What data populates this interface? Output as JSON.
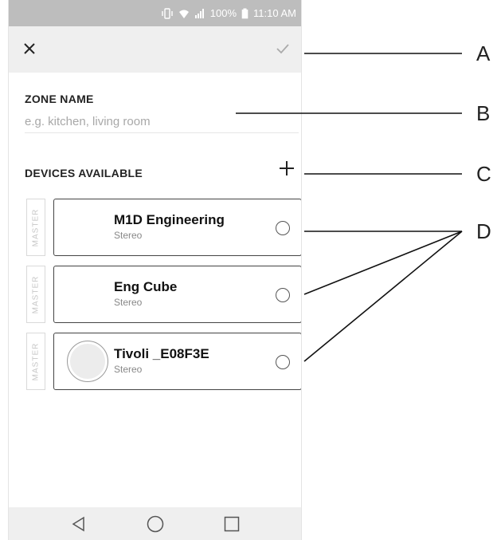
{
  "status_bar": {
    "battery": "100%",
    "time": "11:10 AM"
  },
  "toolbar": {
    "close_icon": "close-icon",
    "confirm_icon": "check-icon"
  },
  "zone": {
    "label": "ZONE NAME",
    "placeholder": "e.g. kitchen, living room",
    "value": ""
  },
  "devices": {
    "label": "DEVICES AVAILABLE",
    "add_icon": "plus-icon",
    "master_label": "MASTER",
    "items": [
      {
        "name": "M1D Engineering",
        "subtitle": "Stereo",
        "has_avatar": false,
        "selected": false
      },
      {
        "name": "Eng Cube",
        "subtitle": "Stereo",
        "has_avatar": false,
        "selected": false
      },
      {
        "name": "Tivoli _E08F3E",
        "subtitle": "Stereo",
        "has_avatar": true,
        "selected": false
      }
    ]
  },
  "nav": {
    "back_icon": "back-triangle-icon",
    "home_icon": "home-circle-icon",
    "recent_icon": "recent-square-icon"
  },
  "callouts": [
    "A",
    "B",
    "C",
    "D"
  ],
  "colors": {
    "toolbar_bg": "#efefef",
    "status_bar_bg": "#bdbdbd",
    "card_border": "#444444"
  }
}
